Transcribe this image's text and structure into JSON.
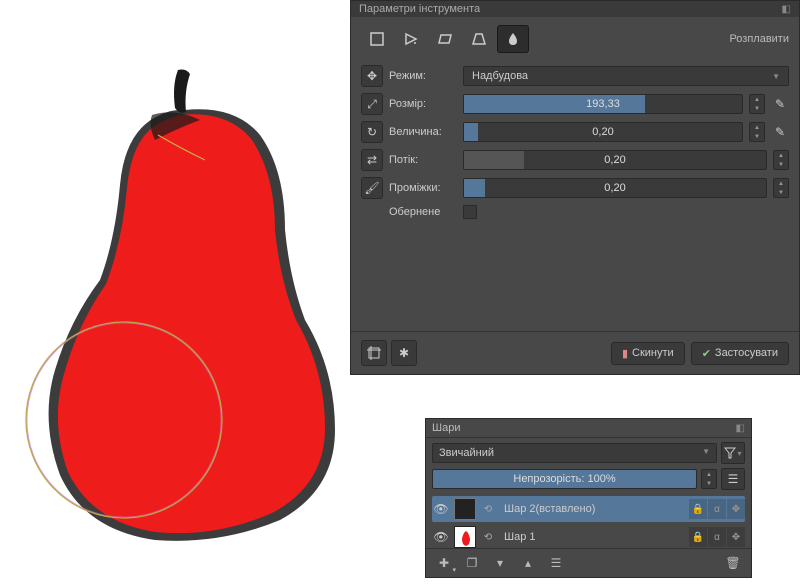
{
  "tool_panel": {
    "title": "Параметри інструмента",
    "right_link": "Розплавити",
    "mode_label": "Режим:",
    "mode_value": "Надбудова",
    "size_label": "Розмір:",
    "size_value": "193,33",
    "magnitude_label": "Величина:",
    "magnitude_value": "0,20",
    "flow_label": "Потік:",
    "flow_value": "0,20",
    "spacing_label": "Проміжки:",
    "spacing_value": "0,20",
    "reverse_label": "Обернене",
    "reset_btn": "Скинути",
    "apply_btn": "Застосувати"
  },
  "layers_panel": {
    "title": "Шари",
    "blend_mode": "Звичайний",
    "opacity_label": "Непрозорість:  100%",
    "layers": [
      {
        "name": "Шар 2(вставлено)"
      },
      {
        "name": "Шар 1"
      }
    ]
  }
}
